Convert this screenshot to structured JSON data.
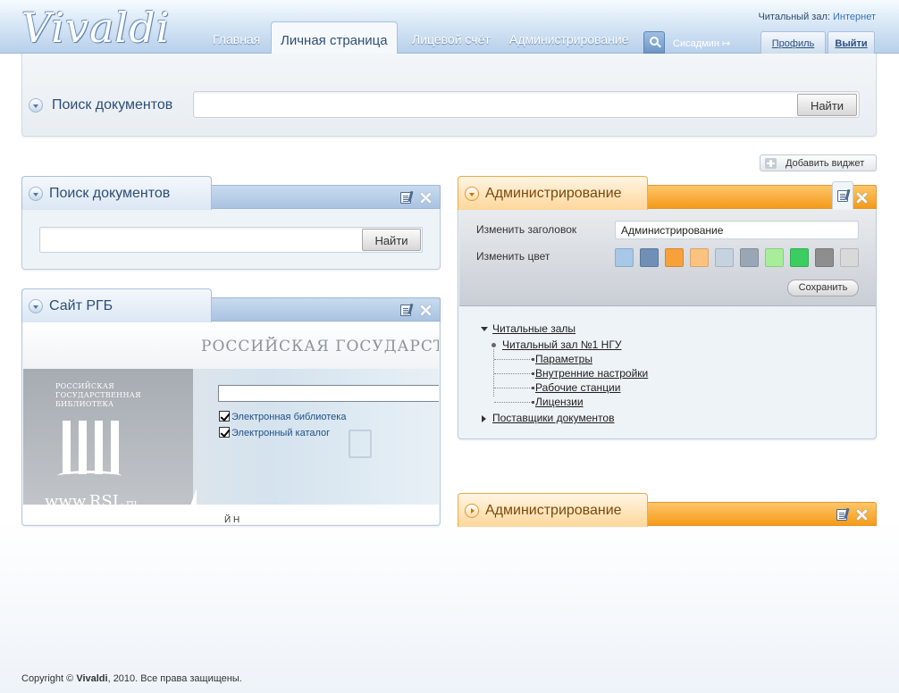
{
  "header": {
    "logo": "Vivaldi",
    "reading_room_label": "Читальный зал:",
    "reading_room_value": "Интернет",
    "nav": [
      "Главная",
      "Личная страница",
      "Лицевой счёт",
      "Администрирование"
    ],
    "active_tab": "Личная страница",
    "user": "Сисадмин",
    "user_arrow": "↦",
    "profile": "Профиль",
    "logout": "Выйти"
  },
  "top_search": {
    "title": "Поиск документов",
    "button": "Найти",
    "value": ""
  },
  "add_widget": "Добавить виджет",
  "widget_search": {
    "title": "Поиск документов",
    "button": "Найти"
  },
  "widget_rgb": {
    "title": "Сайт РГБ",
    "site_title": "РОССИЙСКАЯ ГОСУДАРСТВЕН",
    "logo_text": "РОССИЙСКАЯ ГОСУДАРСТВЕННАЯ БИБЛИОТЕКА",
    "site_url": "www.RSL",
    "site_url_suffix": ".ru",
    "checkbox1": "Электронная библиотека",
    "checkbox2": "Электронный каталог",
    "cut_text": "Й Н"
  },
  "widget_admin": {
    "title": "Администрирование",
    "change_title_label": "Изменить заголовок",
    "change_title_value": "Администрирование",
    "change_color_label": "Изменить цвет",
    "save": "Сохранить",
    "colors": [
      "#a8c8ea",
      "#6f8fb6",
      "#f7a13a",
      "#fbc37e",
      "#c5d3e0",
      "#99a6b5",
      "#a8ee9a",
      "#3ccd62",
      "#8e8e8e",
      "#d9d9d9"
    ],
    "tree": {
      "root": "Читальные залы",
      "child": "Читальный зал №1 НГУ",
      "leaves": [
        "Параметры",
        "Внутренние настройки",
        "Рабочие станции",
        "Лицензии"
      ],
      "root2": "Поставщики документов"
    }
  },
  "widget_admin2": {
    "title": "Администрирование"
  },
  "footer": {
    "prefix": "Copyright ©",
    "brand": "Vivaldi",
    "suffix": ", 2010. Все права защищены."
  }
}
